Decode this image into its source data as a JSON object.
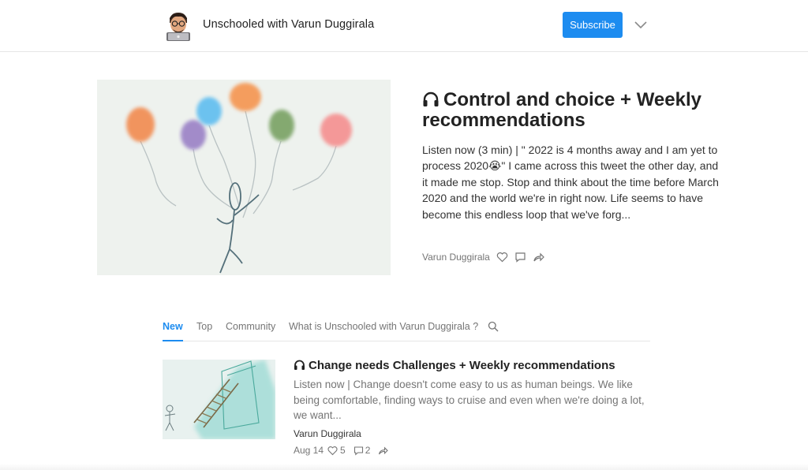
{
  "header": {
    "publication_name": "Unschooled with Varun Duggirala",
    "subscribe_label": "Subscribe"
  },
  "hero": {
    "title": "Control and choice + Weekly recommendations",
    "excerpt": "Listen now (3 min) | \" 2022 is 4 months away and I am yet to process 2020😭\" I came across this tweet the other day, and it made me stop. Stop and think about the time before March 2020 and the world we're in right now. Life seems to have become this endless loop that we've forg...",
    "author": "Varun Duggirala"
  },
  "tabs": [
    {
      "label": "New",
      "active": true
    },
    {
      "label": "Top",
      "active": false
    },
    {
      "label": "Community",
      "active": false
    },
    {
      "label": "What is Unschooled with Varun Duggirala ?",
      "active": false
    }
  ],
  "posts": [
    {
      "title": "Change needs Challenges + Weekly recommendations",
      "excerpt": "Listen now | Change doesn't come easy to us as human beings. We like being comfortable, finding ways to cruise and even when we're doing a lot, we want...",
      "author": "Varun Duggirala",
      "date": "Aug 14",
      "likes": "5",
      "comments": "2"
    }
  ],
  "icons": {
    "headphones": "headphones-icon",
    "like": "heart-icon",
    "comment": "comment-icon",
    "share": "share-icon",
    "search": "search-icon",
    "chevron": "chevron-down-icon"
  },
  "colors": {
    "accent": "#1d8cf0",
    "muted_text": "#757575",
    "body_text": "#222222"
  }
}
